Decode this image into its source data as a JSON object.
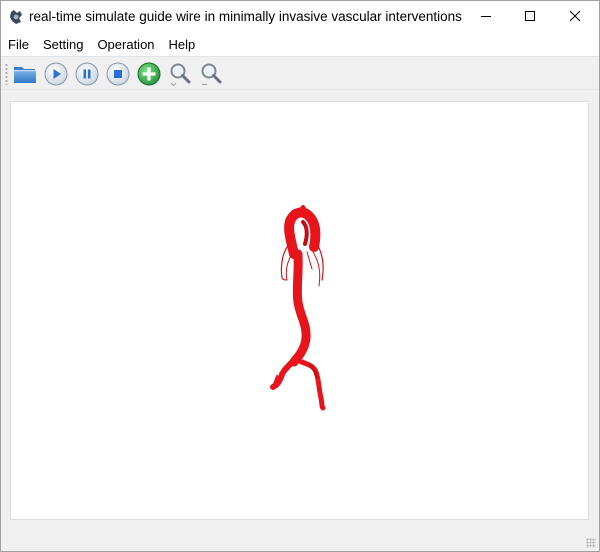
{
  "window": {
    "title": "real-time simulate guide wire in minimally invasive vascular interventions",
    "app_icon": "app-logo-icon"
  },
  "menu": {
    "items": [
      "File",
      "Setting",
      "Operation",
      "Help"
    ]
  },
  "toolbar": {
    "tools": [
      {
        "name": "open-folder-icon"
      },
      {
        "name": "play-icon"
      },
      {
        "name": "pause-icon"
      },
      {
        "name": "stop-icon"
      },
      {
        "name": "add-icon"
      },
      {
        "name": "zoom-in-icon"
      },
      {
        "name": "zoom-out-icon"
      }
    ]
  },
  "colors": {
    "vessel": "#e8141c",
    "accent_blue": "#2b6fd6",
    "add_green": "#2ea043"
  }
}
